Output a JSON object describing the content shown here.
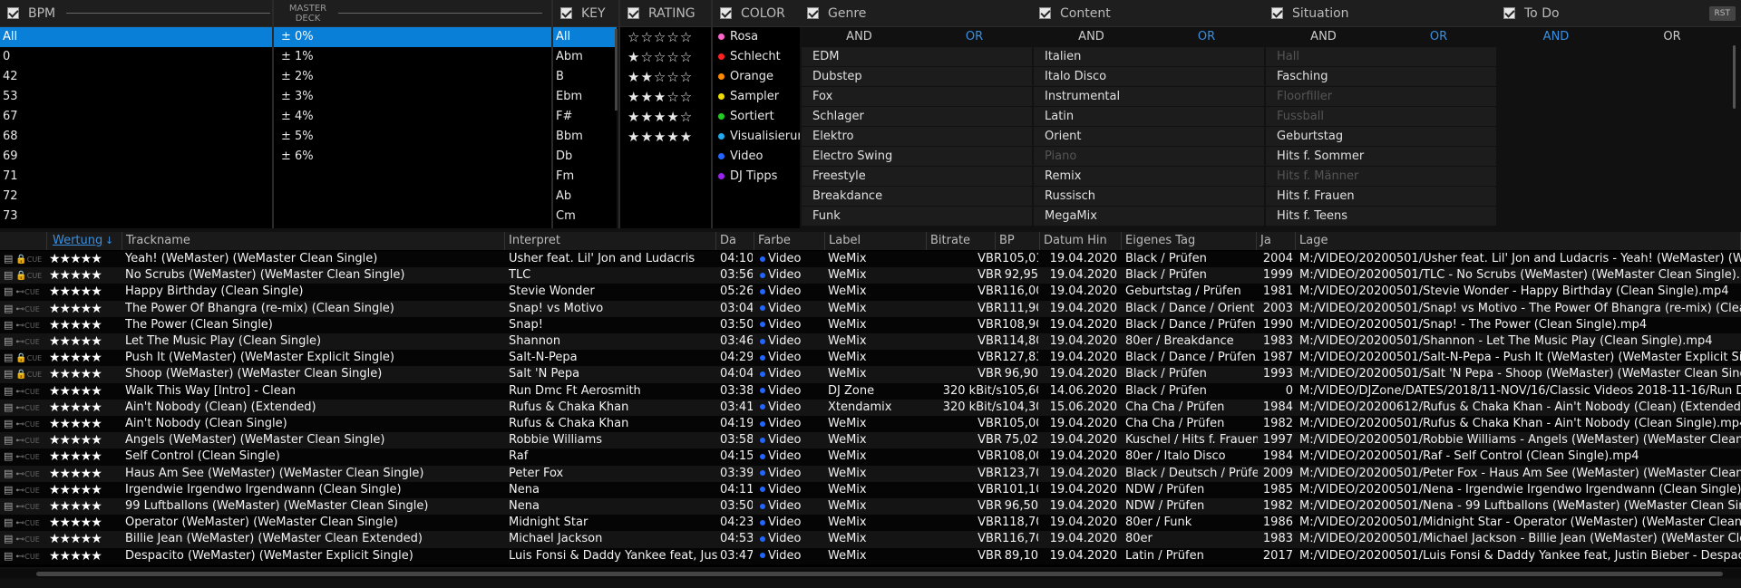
{
  "filters": {
    "bpm": {
      "label": "BPM",
      "items": [
        "All",
        "0",
        "42",
        "53",
        "67",
        "68",
        "69",
        "71",
        "72",
        "73"
      ]
    },
    "master_deck": {
      "label": "MASTER DECK",
      "items": [
        "± 0%",
        "± 1%",
        "± 2%",
        "± 3%",
        "± 4%",
        "± 5%",
        "± 6%"
      ]
    },
    "key": {
      "label": "KEY",
      "items": [
        "All",
        "Abm",
        "B",
        "Ebm",
        "F#",
        "Bbm",
        "Db",
        "Fm",
        "Ab",
        "Cm"
      ]
    },
    "rating": {
      "label": "RATING",
      "items": [
        "☆☆☆☆☆",
        "★☆☆☆☆",
        "★★☆☆☆",
        "★★★☆☆",
        "★★★★☆",
        "★★★★★"
      ]
    },
    "color": {
      "label": "COLOR",
      "items": [
        {
          "name": "Rosa",
          "color": "#ff66cc"
        },
        {
          "name": "Schlecht",
          "color": "#ff2222"
        },
        {
          "name": "Orange",
          "color": "#ff8800"
        },
        {
          "name": "Sampler",
          "color": "#eedd00"
        },
        {
          "name": "Sortiert",
          "color": "#22cc22"
        },
        {
          "name": "Visualisierun",
          "color": "#22aaee"
        },
        {
          "name": "Video",
          "color": "#2266ff"
        },
        {
          "name": "DJ Tipps",
          "color": "#9922ee"
        }
      ]
    },
    "rst_label": "RST",
    "and_label": "AND",
    "or_label": "OR",
    "genre": {
      "label": "Genre",
      "items": [
        [
          "EDM",
          false
        ],
        [
          "Dubstep",
          false
        ],
        [
          "Fox",
          false
        ],
        [
          "Schlager",
          false
        ],
        [
          "Elektro",
          false
        ],
        [
          "Electro Swing",
          false
        ],
        [
          "Freestyle",
          false
        ],
        [
          "Breakdance",
          false
        ],
        [
          "Funk",
          false
        ]
      ]
    },
    "content": {
      "label": "Content",
      "items": [
        [
          "Italien",
          false
        ],
        [
          "Italo Disco",
          false
        ],
        [
          "Instrumental",
          false
        ],
        [
          "Latin",
          false
        ],
        [
          "Orient",
          false
        ],
        [
          "Piano",
          true
        ],
        [
          "Remix",
          false
        ],
        [
          "Russisch",
          false
        ],
        [
          "MegaMix",
          false
        ]
      ]
    },
    "situation": {
      "label": "Situation",
      "items": [
        [
          "Hall",
          true
        ],
        [
          "Fasching",
          false
        ],
        [
          "Floorfiller",
          true
        ],
        [
          "Fussball",
          true
        ],
        [
          "Geburtstag",
          false
        ],
        [
          "Hits f. Sommer",
          false
        ],
        [
          "Hits f. Männer",
          true
        ],
        [
          "Hits f. Frauen",
          false
        ],
        [
          "Hits f. Teens",
          false
        ]
      ]
    },
    "todo": {
      "label": "To Do"
    }
  },
  "table": {
    "headers": [
      "Wertung",
      "Trackname",
      "Interpret",
      "Da",
      "Farbe",
      "Label",
      "Bitrate",
      "BP",
      "Datum Hin",
      "Eigenes Tag",
      "Ja",
      "Lage"
    ],
    "rows": [
      [
        "★★★★★",
        "Yeah! (WeMaster) (WeMaster Clean Single)",
        "Usher feat. Lil' Jon and Ludacris",
        "04:10",
        "Video",
        "WeMix",
        "VBR",
        "105,01",
        "19.04.2020",
        "Black / Prüfen",
        "2004",
        "M:/VIDEO/20200501/Usher feat. Lil' Jon and Ludacris - Yeah! (WeMaster) (WeMa"
      ],
      [
        "★★★★★",
        "No Scrubs (WeMaster) (WeMaster Clean Single)",
        "TLC",
        "03:56",
        "Video",
        "WeMix",
        "VBR",
        "92,95",
        "19.04.2020",
        "Black / Prüfen",
        "1999",
        "M:/VIDEO/20200501/TLC - No Scrubs (WeMaster) (WeMaster Clean Single).mp4"
      ],
      [
        "★★★★★",
        "Happy Birthday  (Clean Single)",
        "Stevie Wonder",
        "05:26",
        "Video",
        "WeMix",
        "VBR",
        "116,00",
        "19.04.2020",
        "Geburtstag / Prüfen",
        "1981",
        "M:/VIDEO/20200501/Stevie Wonder - Happy Birthday  (Clean Single).mp4"
      ],
      [
        "★★★★★",
        "The Power Of Bhangra (re-mix)  (Clean Single)",
        "Snap! vs Motivo",
        "03:04",
        "Video",
        "WeMix",
        "VBR",
        "111,90",
        "19.04.2020",
        "Black / Dance / Orient /",
        "2003",
        "M:/VIDEO/20200501/Snap! vs Motivo - The Power Of Bhangra (re-mix)  (Clean Si"
      ],
      [
        "★★★★★",
        "The Power  (Clean Single)",
        "Snap!",
        "03:50",
        "Video",
        "WeMix",
        "VBR",
        "108,90",
        "19.04.2020",
        "Black / Dance / Prüfen",
        "1990",
        "M:/VIDEO/20200501/Snap! - The Power  (Clean Single).mp4"
      ],
      [
        "★★★★★",
        "Let The Music Play  (Clean Single)",
        "Shannon",
        "03:46",
        "Video",
        "WeMix",
        "VBR",
        "114,80",
        "19.04.2020",
        "80er / Breakdance",
        "1983",
        "M:/VIDEO/20200501/Shannon - Let The Music Play  (Clean Single).mp4"
      ],
      [
        "★★★★★",
        "Push It (WeMaster) (WeMaster Explicit Single)",
        "Salt-N-Pepa",
        "04:29",
        "Video",
        "WeMix",
        "VBR",
        "127,83",
        "19.04.2020",
        "Black / Dance / Prüfen",
        "1987",
        "M:/VIDEO/20200501/Salt-N-Pepa - Push It (WeMaster) (WeMaster Explicit Single"
      ],
      [
        "★★★★★",
        "Shoop (WeMaster) (WeMaster Clean Single)",
        "Salt 'N Pepa",
        "04:04",
        "Video",
        "WeMix",
        "VBR",
        "96,90",
        "19.04.2020",
        "Black / Prüfen",
        "1993",
        "M:/VIDEO/20200501/Salt 'N Pepa - Shoop (WeMaster) (WeMaster Clean Single).mp4"
      ],
      [
        "★★★★★",
        "Walk This Way [Intro] - Clean",
        "Run Dmc Ft Aerosmith",
        "03:38",
        "Video",
        "DJ Zone",
        "320 kBit/s",
        "105,60",
        "14.06.2020",
        "Black / Prüfen",
        "0",
        "M:/VIDEO/DJZone/DATES/2018/11-NOV/16/Classic Videos 2018-11-16/Run Dmc"
      ],
      [
        "★★★★★",
        "Ain't Nobody (Clean) (Extended)",
        "Rufus & Chaka Khan",
        "03:41",
        "Video",
        "Xtendamix",
        "320 kBit/s",
        "104,30",
        "15.06.2020",
        "Cha Cha / Prüfen",
        "1984",
        "M:/VIDEO/20200612/Rufus & Chaka Khan - Ain't Nobody (Clean) (Extended).mp4"
      ],
      [
        "★★★★★",
        "Ain't Nobody  (Clean Single)",
        "Rufus & Chaka Khan",
        "04:19",
        "Video",
        "WeMix",
        "VBR",
        "105,00",
        "19.04.2020",
        "Cha Cha / Prüfen",
        "1982",
        "M:/VIDEO/20200501/Rufus & Chaka Khan - Ain't Nobody  (Clean Single).mp4"
      ],
      [
        "★★★★★",
        "Angels (WeMaster) (WeMaster Clean Single)",
        "Robbie Williams",
        "03:58",
        "Video",
        "WeMix",
        "VBR",
        "75,02",
        "19.04.2020",
        "Kuschel / Hits f. Frauen",
        "1997",
        "M:/VIDEO/20200501/Robbie Williams - Angels (WeMaster) (WeMaster Clean Sing"
      ],
      [
        "★★★★★",
        "Self Control  (Clean Single)",
        "Raf",
        "04:15",
        "Video",
        "WeMix",
        "VBR",
        "108,00",
        "19.04.2020",
        "80er / Italo Disco",
        "1984",
        "M:/VIDEO/20200501/Raf - Self Control  (Clean Single).mp4"
      ],
      [
        "★★★★★",
        "Haus Am See (WeMaster) (WeMaster Clean Single)",
        "Peter Fox",
        "03:39",
        "Video",
        "WeMix",
        "VBR",
        "123,70",
        "19.04.2020",
        "Black / Deutsch / Prüfe",
        "2009",
        "M:/VIDEO/20200501/Peter Fox - Haus Am See (WeMaster) (WeMaster Clean Sin"
      ],
      [
        "★★★★★",
        "Irgendwie Irgendwo Irgendwann  (Clean Single)",
        "Nena",
        "04:11",
        "Video",
        "WeMix",
        "VBR",
        "101,10",
        "19.04.2020",
        "NDW / Prüfen",
        "1985",
        "M:/VIDEO/20200501/Nena - Irgendwie Irgendwo Irgendwann  (Clean Single).mp4"
      ],
      [
        "★★★★★",
        "99 Luftballons (WeMaster) (WeMaster Clean Single)",
        "Nena",
        "03:50",
        "Video",
        "WeMix",
        "VBR",
        "96,50",
        "19.04.2020",
        "NDW / Prüfen",
        "1982",
        "M:/VIDEO/20200501/Nena - 99 Luftballons (WeMaster) (WeMaster Clean Single)"
      ],
      [
        "★★★★★",
        "Operator (WeMaster) (WeMaster Clean Single)",
        "Midnight Star",
        "04:23",
        "Video",
        "WeMix",
        "VBR",
        "118,70",
        "19.04.2020",
        "80er / Funk",
        "1986",
        "M:/VIDEO/20200501/Midnight Star - Operator (WeMaster) (WeMaster Clean Sing"
      ],
      [
        "★★★★★",
        "Billie Jean (WeMaster) (WeMaster Clean Extended)",
        "Michael Jackson",
        "04:53",
        "Video",
        "WeMix",
        "VBR",
        "116,70",
        "19.04.2020",
        "80er",
        "1983",
        "M:/VIDEO/20200501/Michael Jackson - Billie Jean (WeMaster) (WeMaster Clean"
      ],
      [
        "★★★★★",
        "Despacito (WeMaster) (WeMaster Explicit Single)",
        "Luis Fonsi & Daddy Yankee feat, Justi",
        "03:47",
        "Video",
        "WeMix",
        "VBR",
        "89,10",
        "19.04.2020",
        "Latin / Prüfen",
        "2017",
        "M:/VIDEO/20200501/Luis Fonsi & Daddy Yankee feat, Justin Bieber - Despacito ("
      ]
    ]
  }
}
